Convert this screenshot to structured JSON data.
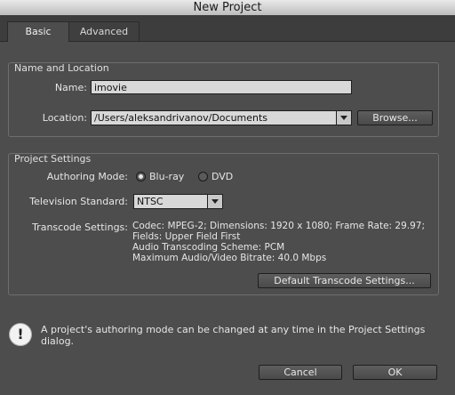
{
  "window": {
    "title": "New Project"
  },
  "tabs": [
    {
      "label": "Basic",
      "active": true
    },
    {
      "label": "Advanced",
      "active": false
    }
  ],
  "name_location": {
    "title": "Name and Location",
    "name_label": "Name:",
    "name_value": "imovie",
    "location_label": "Location:",
    "location_value": "/Users/aleksandrivanov/Documents",
    "browse_label": "Browse..."
  },
  "project_settings": {
    "title": "Project Settings",
    "authoring_label": "Authoring Mode:",
    "authoring_options": [
      {
        "label": "Blu-ray",
        "selected": true
      },
      {
        "label": "DVD",
        "selected": false
      }
    ],
    "tv_label": "Television Standard:",
    "tv_value": "NTSC",
    "transcode_label": "Transcode Settings:",
    "transcode_lines": [
      "Codec: MPEG-2; Dimensions: 1920 x 1080; Frame Rate: 29.97;",
      "Fields: Upper Field First",
      "Audio Transcoding Scheme: PCM",
      "Maximum Audio/Video Bitrate: 40.0 Mbps"
    ],
    "default_transcode_label": "Default Transcode Settings..."
  },
  "info": {
    "icon": "exclamation-icon",
    "text": "A project's authoring mode can be changed at any time in the Project Settings dialog."
  },
  "buttons": {
    "cancel": "Cancel",
    "ok": "OK"
  },
  "colors": {
    "background": "#4d4d4d",
    "field": "#d8d8d8",
    "title_bar": "#d4d4d4"
  }
}
